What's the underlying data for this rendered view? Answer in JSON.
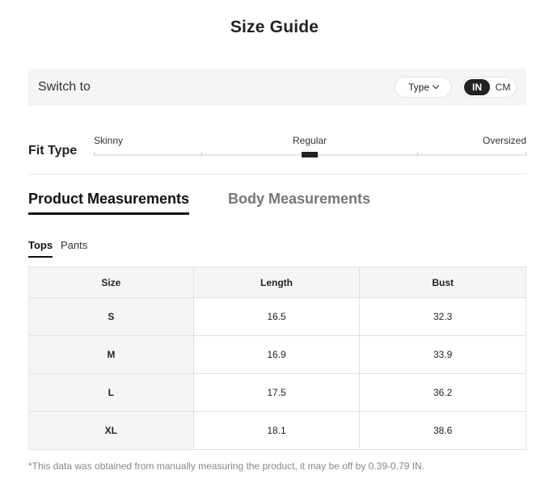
{
  "title": "Size Guide",
  "switch_bar": {
    "label": "Switch to",
    "type_select": "Type",
    "units": {
      "in": "IN",
      "cm": "CM",
      "selected": "IN"
    }
  },
  "fit_type": {
    "title": "Fit Type",
    "labels": [
      "Skinny",
      "Regular",
      "Oversized"
    ],
    "selected": "Regular"
  },
  "main_tabs": [
    {
      "label": "Product Measurements",
      "active": true
    },
    {
      "label": "Body Measurements",
      "active": false
    }
  ],
  "sub_tabs": [
    {
      "label": "Tops",
      "active": true
    },
    {
      "label": "Pants",
      "active": false
    }
  ],
  "table": {
    "headers": [
      "Size",
      "Length",
      "Bust"
    ],
    "rows": [
      [
        "S",
        "16.5",
        "32.3"
      ],
      [
        "M",
        "16.9",
        "33.9"
      ],
      [
        "L",
        "17.5",
        "36.2"
      ],
      [
        "XL",
        "18.1",
        "38.6"
      ]
    ]
  },
  "footnote": "*This data was obtained from manually measuring the product, it may be off by 0.39-0.79 IN."
}
